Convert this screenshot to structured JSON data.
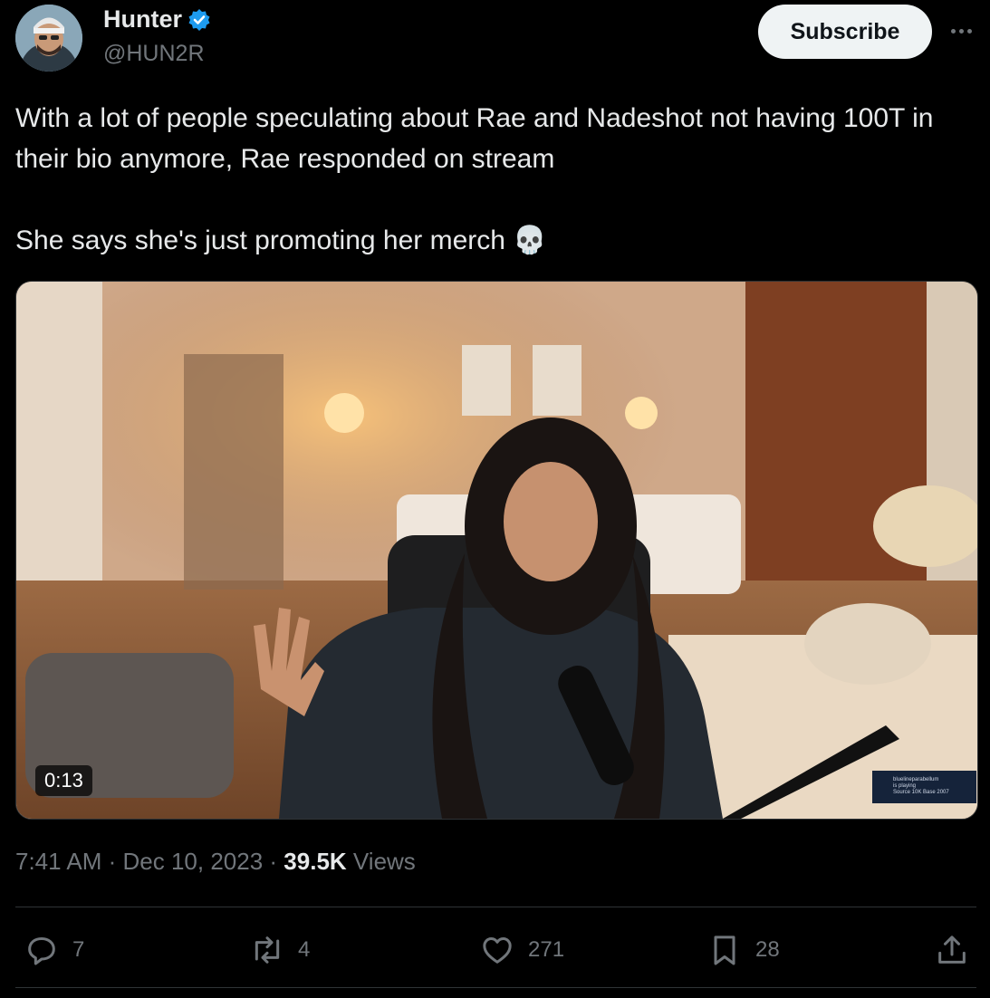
{
  "author": {
    "name": "Hunter",
    "handle": "@HUN2R",
    "verified": true,
    "avatar_icon": "avatar-photo"
  },
  "header": {
    "subscribe_label": "Subscribe",
    "more_icon": "more-horizontal-icon"
  },
  "tweet": {
    "text": "With a lot of people speculating about Rae and Nadeshot not having 100T in their bio anymore, Rae responded on stream\n\nShe says she's just promoting her merch 💀"
  },
  "media": {
    "type": "video",
    "duration": "0:13",
    "overlay_name": "bluelineparabellum",
    "overlay_status": "is playing",
    "overlay_game": "Source 10K Base 2007"
  },
  "meta": {
    "time": "7:41 AM",
    "date": "Dec 10, 2023",
    "separator": " · ",
    "views_count": "39.5K",
    "views_label": "Views"
  },
  "actions": {
    "replies": "7",
    "reposts": "4",
    "likes": "271",
    "bookmarks": "28"
  },
  "colors": {
    "background": "#000000",
    "text": "#e7e9ea",
    "muted": "#71767b",
    "verified": "#1d9bf0",
    "divider": "#2f3336"
  }
}
